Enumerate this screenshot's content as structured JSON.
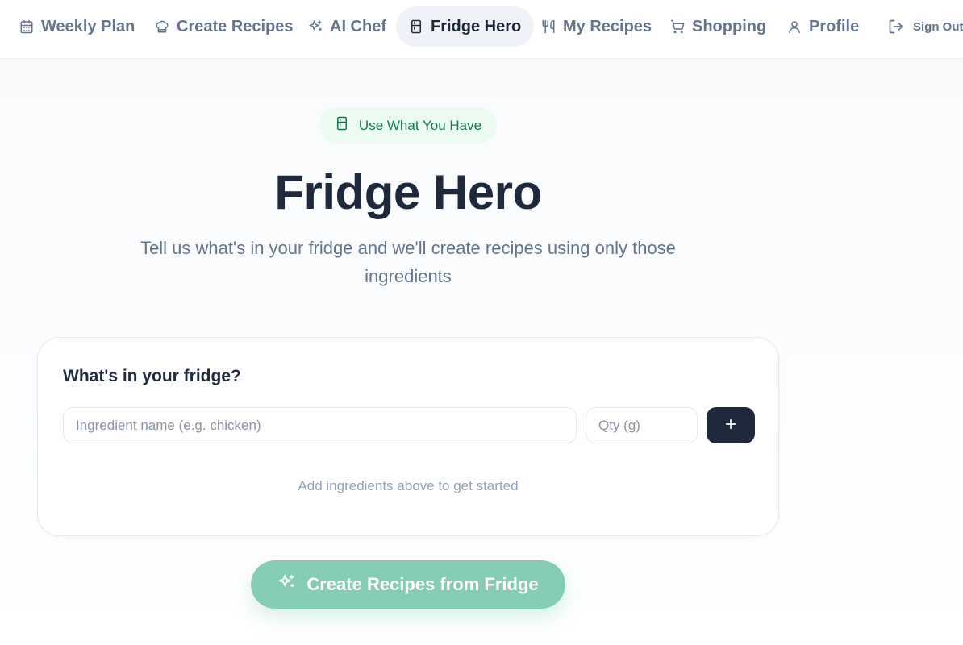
{
  "nav": {
    "items": [
      {
        "label": "Weekly Plan",
        "icon": "calendar-icon"
      },
      {
        "label": "Create Recipes",
        "icon": "chef-hat-icon"
      },
      {
        "label": "AI Chef",
        "icon": "sparkles-icon"
      },
      {
        "label": "Fridge Hero",
        "icon": "fridge-icon",
        "active": true
      },
      {
        "label": "My Recipes",
        "icon": "utensils-icon"
      },
      {
        "label": "Shopping",
        "icon": "cart-icon"
      },
      {
        "label": "Profile",
        "icon": "user-icon"
      }
    ],
    "signout_label": "Sign Out"
  },
  "hero": {
    "badge": "Use What You Have",
    "title": "Fridge Hero",
    "subtitle": "Tell us what's in your fridge and we'll create recipes using only those ingredients"
  },
  "fridge_card": {
    "title": "What's in your fridge?",
    "ingredient_value": "",
    "ingredient_placeholder": "Ingredient name (e.g. chicken)",
    "qty_value": "",
    "qty_placeholder": "Qty (g)",
    "empty_message": "Add ingredients above to get started"
  },
  "actions": {
    "create_label": "Create Recipes from Fridge"
  },
  "colors": {
    "primary_dark": "#1e293b",
    "accent_green": "#16794a",
    "badge_bg": "#ebfbf2",
    "create_button": "#85ccb7",
    "muted_text": "#64748b"
  }
}
